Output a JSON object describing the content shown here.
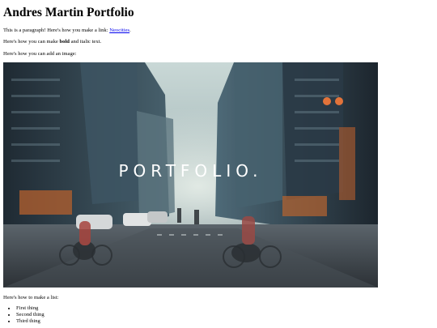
{
  "page": {
    "title": "Andres Martin Portfolio",
    "intro": {
      "before": "This is a paragraph! Here's how you make a link: ",
      "link_text": "Neocities",
      "after": "."
    },
    "bold_line": {
      "before": "Here's how you can make ",
      "bold": "bold",
      "after": " and italic text."
    },
    "image_line": "Here's how you can add an image:",
    "image": {
      "overlay_text": "PORTFOLIO.",
      "subject": "city street at dusk with cyclists, traffic and skyscrapers"
    },
    "list_line": "Here's how to make a list:",
    "list_items": [
      "First thing",
      "Second thing",
      "Third thing"
    ]
  }
}
